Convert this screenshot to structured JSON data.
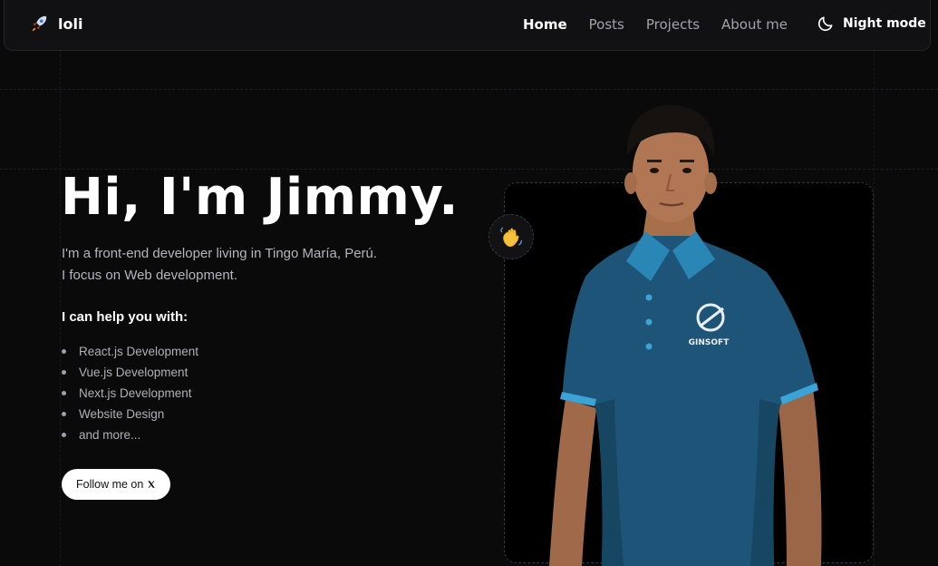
{
  "brand": {
    "name": "loli",
    "icon": "rocket-icon"
  },
  "nav": {
    "links": [
      {
        "label": "Home",
        "active": true
      },
      {
        "label": "Posts",
        "active": false
      },
      {
        "label": "Projects",
        "active": false
      },
      {
        "label": "About me",
        "active": false
      }
    ],
    "night_mode": {
      "label": "Night mode",
      "icon": "moon-icon"
    }
  },
  "hero": {
    "title": "Hi, I'm Jimmy.",
    "desc_line1": "I'm a front-end developer living in Tingo María, Perú.",
    "desc_line2": "I focus on Web development.",
    "help_heading": "I can help you with:",
    "skills": [
      "React.js Development",
      "Vue.js Development",
      "Next.js Development",
      "Website Design",
      "and more..."
    ],
    "follow_label": "Follow me on",
    "follow_icon": "x-logo-icon"
  },
  "profile": {
    "badge_icon": "waving-hand-icon",
    "shirt_logo_text": "GINSOFT"
  },
  "colors": {
    "background": "#0a0a0b",
    "navbar": "#111113",
    "shirt": "#1d5477",
    "text_muted": "#b5b5ba"
  }
}
